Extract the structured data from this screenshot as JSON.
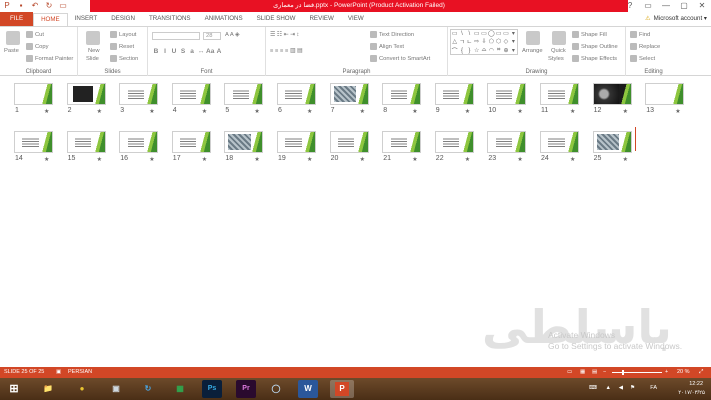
{
  "window": {
    "title": "فضا در معماری.pptx - PowerPoint (Product Activation Failed)",
    "controls": [
      "?",
      "▭",
      "—",
      "▢",
      "✕"
    ]
  },
  "tabs": [
    {
      "label": "FILE"
    },
    {
      "label": "HOME"
    },
    {
      "label": "INSERT"
    },
    {
      "label": "DESIGN"
    },
    {
      "label": "TRANSITIONS"
    },
    {
      "label": "ANIMATIONS"
    },
    {
      "label": "SLIDE SHOW"
    },
    {
      "label": "REVIEW"
    },
    {
      "label": "VIEW"
    }
  ],
  "account": "Microsoft account",
  "ribbon": {
    "clipboard": {
      "label": "Clipboard",
      "paste": "Paste",
      "cut": "Cut",
      "copy": "Copy",
      "format_painter": "Format Painter"
    },
    "slides": {
      "label": "Slides",
      "new_slide": "New",
      "new_slide2": "Slide",
      "layout": "Layout",
      "reset": "Reset",
      "section": "Section"
    },
    "font": {
      "label": "Font",
      "size": "28"
    },
    "paragraph": {
      "label": "Paragraph",
      "text_direction": "Text Direction",
      "align_text": "Align Text",
      "convert": "Convert to SmartArt"
    },
    "drawing": {
      "label": "Drawing",
      "arrange": "Arrange",
      "quick_styles": "Quick",
      "quick_styles2": "Styles",
      "shape_fill": "Shape Fill",
      "shape_outline": "Shape Outline",
      "shape_effects": "Shape Effects"
    },
    "editing": {
      "label": "Editing",
      "find": "Find",
      "replace": "Replace",
      "select": "Select"
    }
  },
  "slides": [
    {
      "n": "1",
      "kind": "blank"
    },
    {
      "n": "2",
      "kind": "dark"
    },
    {
      "n": "3",
      "kind": "text"
    },
    {
      "n": "4",
      "kind": "text"
    },
    {
      "n": "5",
      "kind": "text"
    },
    {
      "n": "6",
      "kind": "text"
    },
    {
      "n": "7",
      "kind": "photo"
    },
    {
      "n": "8",
      "kind": "text"
    },
    {
      "n": "9",
      "kind": "text"
    },
    {
      "n": "10",
      "kind": "text"
    },
    {
      "n": "11",
      "kind": "text"
    },
    {
      "n": "12",
      "kind": "dark2"
    },
    {
      "n": "13",
      "kind": "blank"
    },
    {
      "n": "14",
      "kind": "text"
    },
    {
      "n": "15",
      "kind": "text"
    },
    {
      "n": "16",
      "kind": "text"
    },
    {
      "n": "17",
      "kind": "text"
    },
    {
      "n": "18",
      "kind": "photo"
    },
    {
      "n": "19",
      "kind": "text"
    },
    {
      "n": "20",
      "kind": "text"
    },
    {
      "n": "21",
      "kind": "text"
    },
    {
      "n": "22",
      "kind": "text"
    },
    {
      "n": "23",
      "kind": "text"
    },
    {
      "n": "24",
      "kind": "text"
    },
    {
      "n": "25",
      "kind": "photo"
    }
  ],
  "star": "★",
  "watermark": "باسلطی",
  "activation": {
    "line1": "Activate Windows",
    "line2": "Go to Settings to activate Windows."
  },
  "status": {
    "slide": "SLIDE 25 OF 25",
    "language": "PERSIAN",
    "zoom": "20 %",
    "zoom_level": 0.2
  },
  "taskbar": {
    "apps": [
      "⊞",
      "📁",
      "●",
      "▣",
      "↻",
      "▦",
      "Ps",
      "Pr",
      "◯",
      "W",
      "P"
    ],
    "lang": "FA",
    "time": "12:22",
    "date": "۲۰۱۷/۰۳/۲۵"
  },
  "colors": {
    "accent": "#d24726",
    "title_red": "#e81123",
    "thumb_green": "#8dc63f"
  }
}
